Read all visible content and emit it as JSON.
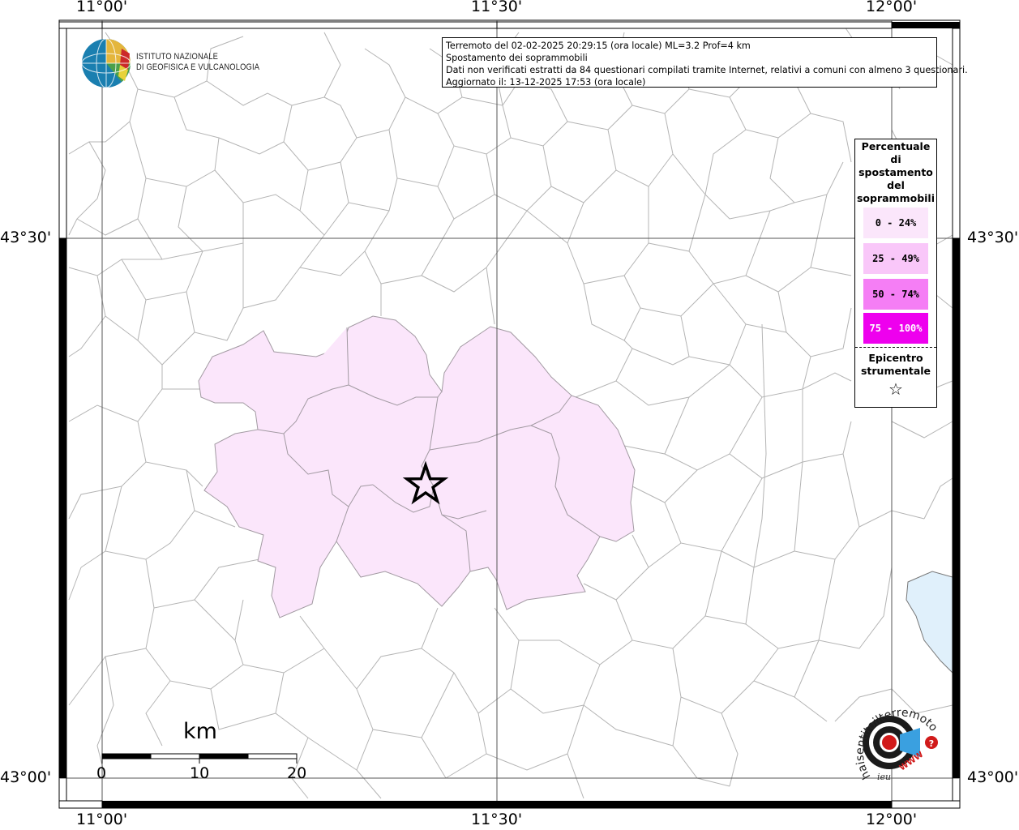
{
  "map": {
    "top_labels": [
      "11°00'",
      "11°30'",
      "12°00'"
    ],
    "bottom_labels": [
      "11°00'",
      "11°30'",
      "12°00'"
    ],
    "left_labels": [
      "43°30'",
      "43°00'"
    ],
    "right_labels": [
      "43°30'",
      "43°00'"
    ]
  },
  "title_box": {
    "line1": "Terremoto del 02-02-2025 20:29:15 (ora locale) ML=3.2 Prof=4 km",
    "line2": "Spostamento dei soprammobili",
    "line3": "Dati non verificati estratti da 84 questionari compilati tramite Internet, relativi a comuni con almeno 3 questionari.",
    "line4": "Aggiornato il: 13-12-2025 17:53 (ora locale)"
  },
  "logo": {
    "line1": "ISTITUTO NAZIONALE",
    "line2": "DI GEOFISICA E VULCANOLOGIA"
  },
  "legend": {
    "title": [
      "Percentuale",
      "di",
      "spostamento",
      "del",
      "soprammobili"
    ],
    "items": [
      {
        "label": "0 - 24%",
        "color": "#fbe6fb"
      },
      {
        "label": "25 - 49%",
        "color": "#f9c7f9"
      },
      {
        "label": "50 - 74%",
        "color": "#f57ef5"
      },
      {
        "label": "75 - 100%",
        "color": "#ee00ee"
      }
    ],
    "epicenter_title": [
      "Epicentro",
      "strumentale"
    ],
    "epicenter_symbol": "☆"
  },
  "scale_bar": {
    "unit": "km",
    "ticks": [
      "0",
      "10",
      "20"
    ]
  },
  "badge": {
    "text": "haisentitoilterremoto.it",
    "www": "WWW",
    "letters": "ieu"
  },
  "colors": {
    "fill_low": "#fbe6fb",
    "border": "#aaaaaa",
    "water": "#e0f0fb"
  }
}
